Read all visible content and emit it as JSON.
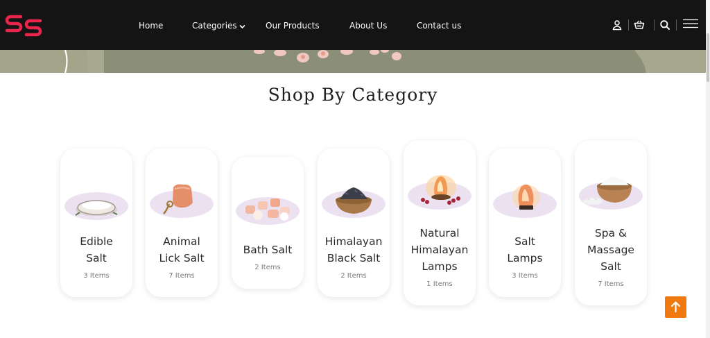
{
  "header": {
    "nav": [
      {
        "label": "Home"
      },
      {
        "label": "Categories"
      },
      {
        "label": "Our Products"
      },
      {
        "label": "About Us"
      },
      {
        "label": "Contact us"
      }
    ],
    "icons": [
      "user-icon",
      "cart-icon",
      "search-icon",
      "menu-icon"
    ],
    "brand_color": "#e8254a"
  },
  "section": {
    "title": "Shop By Category"
  },
  "categories": [
    {
      "name_line1": "Edible",
      "name_line2": "Salt",
      "name_line3": "",
      "count": "3 Items"
    },
    {
      "name_line1": "Animal",
      "name_line2": "Lick Salt",
      "name_line3": "",
      "count": "7 Items"
    },
    {
      "name_line1": "Bath Salt",
      "name_line2": "",
      "name_line3": "",
      "count": "2 Items"
    },
    {
      "name_line1": "Himalayan",
      "name_line2": "Black Salt",
      "name_line3": "",
      "count": "2 Items"
    },
    {
      "name_line1": "Natural",
      "name_line2": "Himalayan",
      "name_line3": "Lamps",
      "count": "1 Items"
    },
    {
      "name_line1": "Salt",
      "name_line2": "Lamps",
      "name_line3": "",
      "count": "3 Items"
    },
    {
      "name_line1": "Spa &",
      "name_line2": "Massage",
      "name_line3": "Salt",
      "count": "7 Items"
    }
  ],
  "accent_color": "#f07a10"
}
